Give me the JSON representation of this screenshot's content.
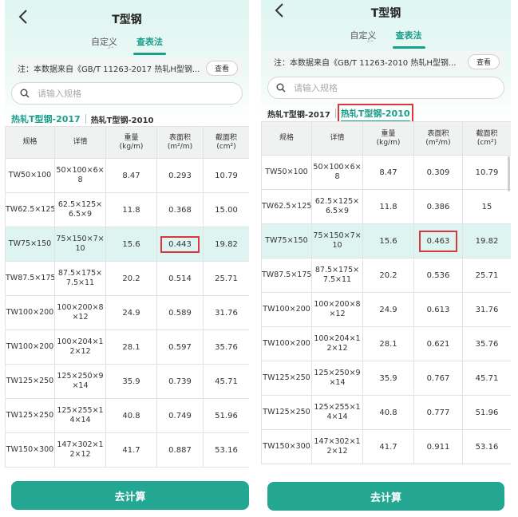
{
  "left": {
    "title": "T型钢",
    "tabs": [
      {
        "label": "自定义"
      },
      {
        "label": "查表法"
      }
    ],
    "tab_sub": "2→",
    "note_text": "注：本数据来自《GB/T 11263-2017 热轧H型钢...",
    "note_button": "查看",
    "search_placeholder": "请输入规格",
    "std_tabs": [
      {
        "label": "热轧T型钢-2017"
      },
      {
        "label": "热轧T型钢-2010"
      }
    ],
    "headers": [
      "规格",
      "详情",
      "重量\n(kg/m)",
      "表面积\n(m²/m)",
      "截面积\n(cm²)"
    ],
    "rows": [
      [
        "TW50×100",
        "50×100×6×8",
        "8.47",
        "0.293",
        "10.79"
      ],
      [
        "TW62.5×125",
        "62.5×125×6.5×9",
        "11.8",
        "0.368",
        "15.00"
      ],
      [
        "TW75×150",
        "75×150×7×10",
        "15.6",
        "0.443",
        "19.82"
      ],
      [
        "TW87.5×175",
        "87.5×175×7.5×11",
        "20.2",
        "0.514",
        "25.71"
      ],
      [
        "TW100×200",
        "100×200×8×12",
        "24.9",
        "0.589",
        "31.76"
      ],
      [
        "TW100×200",
        "100×204×12×12",
        "28.1",
        "0.597",
        "35.76"
      ],
      [
        "TW125×250",
        "125×250×9×14",
        "35.9",
        "0.739",
        "45.71"
      ],
      [
        "TW125×250",
        "125×255×14×14",
        "40.8",
        "0.749",
        "51.96"
      ],
      [
        "TW150×300",
        "147×302×12×12",
        "41.7",
        "0.887",
        "53.16"
      ]
    ],
    "calc_button": "去计算"
  },
  "right": {
    "title": "T型钢",
    "tabs": [
      {
        "label": "自定义"
      },
      {
        "label": "查表法"
      }
    ],
    "tab_sub": "2→",
    "note_text": "注：本数据来自《GB/T 11263-2010 热轧H型钢...",
    "note_button": "查看",
    "search_placeholder": "请输入规格",
    "std_tabs": [
      {
        "label": "热轧T型钢-2017"
      },
      {
        "label": "热轧T型钢-2010"
      }
    ],
    "headers": [
      "规格",
      "详情",
      "重量\n(kg/m)",
      "表面积\n(m²/m)",
      "截面积\n(cm²)"
    ],
    "rows": [
      [
        "TW50×100",
        "50×100×6×8",
        "8.47",
        "0.309",
        "10.79"
      ],
      [
        "TW62.5×125",
        "62.5×125×6.5×9",
        "11.8",
        "0.386",
        "15"
      ],
      [
        "TW75×150",
        "75×150×7×10",
        "15.6",
        "0.463",
        "19.82"
      ],
      [
        "TW87.5×175",
        "87.5×175×7.5×11",
        "20.2",
        "0.536",
        "25.71"
      ],
      [
        "TW100×200",
        "100×200×8×12",
        "24.9",
        "0.613",
        "31.76"
      ],
      [
        "TW100×200",
        "100×204×12×12",
        "28.1",
        "0.621",
        "35.76"
      ],
      [
        "TW125×250",
        "125×250×9×14",
        "35.9",
        "0.767",
        "45.71"
      ],
      [
        "TW125×250",
        "125×255×14×14",
        "40.8",
        "0.777",
        "51.96"
      ],
      [
        "TW150×300",
        "147×302×12×12",
        "41.7",
        "0.911",
        "53.16"
      ]
    ],
    "calc_button": "去计算"
  },
  "colors": {
    "accent": "#1a9e8a",
    "button": "#23a793",
    "highlight_row": "#def4f0",
    "annotation": "#d9363e"
  },
  "icons": {
    "back": "chevron-left-icon",
    "search": "search-icon"
  }
}
